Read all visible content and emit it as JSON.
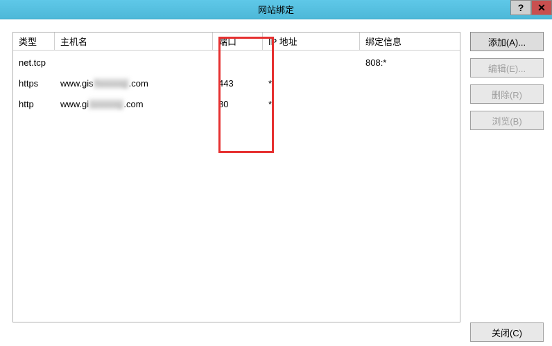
{
  "titlebar": {
    "title": "网站绑定",
    "help": "?",
    "close": "✕"
  },
  "table": {
    "headers": {
      "type": "类型",
      "host": "主机名",
      "port": "端口",
      "ip": "IP 地址",
      "bind": "绑定信息"
    },
    "rows": [
      {
        "type": "net.tcp",
        "host": "",
        "host_prefix": "",
        "host_blur": "",
        "host_suffix": "",
        "port": "",
        "ip": "",
        "bind": "808:*"
      },
      {
        "type": "https",
        "host_prefix": "www.gis",
        "host_blur": "hxxxxxg",
        "host_suffix": ".com",
        "port": "443",
        "ip": "*",
        "bind": ""
      },
      {
        "type": "http",
        "host_prefix": "www.gi",
        "host_blur": "sxxxxxg",
        "host_suffix": ".com",
        "port": "80",
        "ip": "*",
        "bind": ""
      }
    ]
  },
  "buttons": {
    "add": "添加(A)...",
    "edit": "编辑(E)...",
    "delete": "删除(R)",
    "browse": "浏览(B)",
    "close": "关闭(C)"
  }
}
